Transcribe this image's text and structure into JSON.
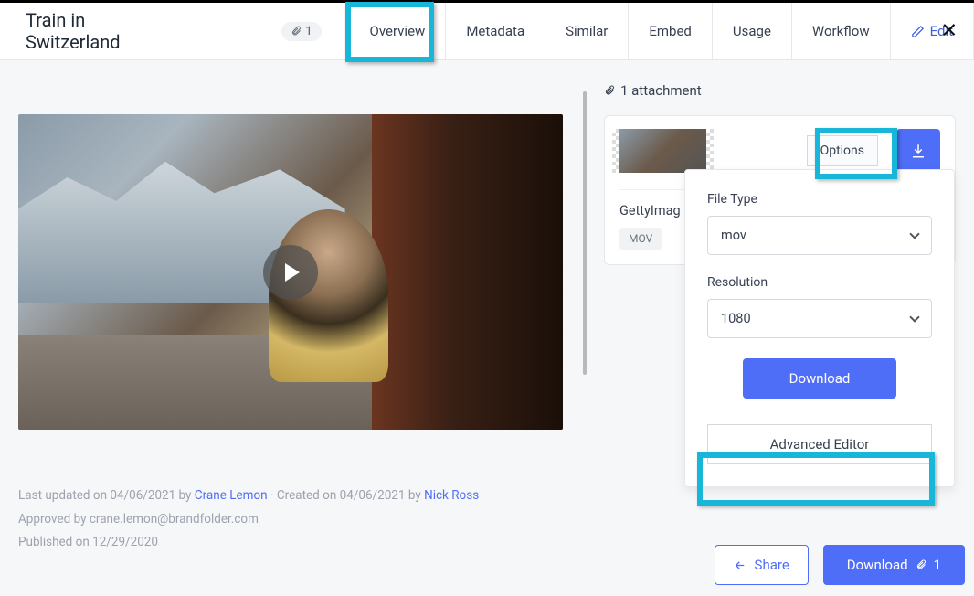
{
  "header": {
    "title": "Train in Switzerland",
    "attachment_count": "1",
    "tabs": [
      "Overview",
      "Metadata",
      "Similar",
      "Embed",
      "Usage",
      "Workflow"
    ],
    "edit_label": "Edit"
  },
  "attachments": {
    "header": "1 attachment",
    "options_label": "Options",
    "filename": "GettyImag",
    "badge": "MOV"
  },
  "options_panel": {
    "file_type_label": "File Type",
    "file_type_value": "mov",
    "resolution_label": "Resolution",
    "resolution_value": "1080",
    "download_label": "Download",
    "advanced_label": "Advanced Editor"
  },
  "meta": {
    "last_updated_prefix": "Last updated on 04/06/2021 by ",
    "last_updated_user": "Crane Lemon",
    "created_sep": " · Created on 04/06/2021 by ",
    "created_user": "Nick Ross",
    "approved": "Approved by crane.lemon@brandfolder.com",
    "published": "Published on 12/29/2020"
  },
  "footer": {
    "share_label": "Share",
    "download_label": "Download",
    "download_count": "1"
  }
}
